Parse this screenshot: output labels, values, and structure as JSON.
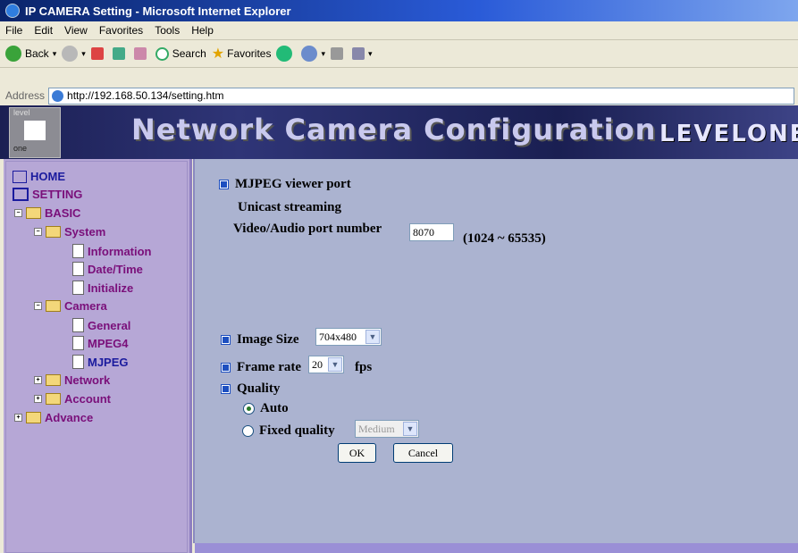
{
  "window": {
    "title": "IP CAMERA Setting - Microsoft Internet Explorer"
  },
  "menu": [
    "File",
    "Edit",
    "View",
    "Favorites",
    "Tools",
    "Help"
  ],
  "toolbar": {
    "back": "Back",
    "search": "Search",
    "favorites": "Favorites"
  },
  "address": {
    "label": "Address",
    "url": "http://192.168.50.134/setting.htm"
  },
  "banner": {
    "title": "Network Camera Configuration",
    "brand": "LEVELONE",
    "logo_top": "level",
    "logo_bottom": "one"
  },
  "tree": {
    "home": "HOME",
    "setting": "SETTING",
    "basic": "BASIC",
    "system": "System",
    "information": "Information",
    "datetime": "Date/Time",
    "initialize": "Initialize",
    "camera": "Camera",
    "general": "General",
    "mpeg4": "MPEG4",
    "mjpeg": "MJPEG",
    "network": "Network",
    "account": "Account",
    "advance": "Advance"
  },
  "form": {
    "viewer_port_heading": "MJPEG viewer port",
    "unicast": "Unicast streaming",
    "port_label": "Video/Audio port number",
    "port_value": "8070",
    "port_range": "(1024 ~ 65535)",
    "image_size_label": "Image Size",
    "image_size_value": "704x480",
    "frame_rate_label": "Frame rate",
    "frame_rate_value": "20",
    "fps": "fps",
    "quality_label": "Quality",
    "auto": "Auto",
    "fixed_quality": "Fixed quality",
    "fixed_value": "Medium",
    "quality_mode": "auto",
    "ok": "OK",
    "cancel": "Cancel"
  }
}
